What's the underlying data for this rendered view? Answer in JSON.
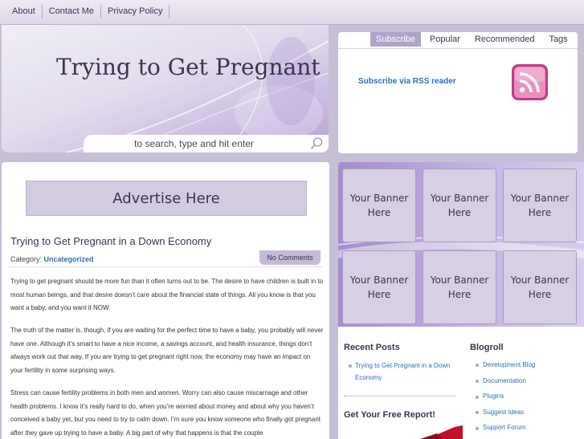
{
  "nav": {
    "items": [
      "About",
      "Contact Me",
      "Privacy Policy"
    ]
  },
  "header": {
    "title": "Trying to Get Pregnant"
  },
  "search": {
    "placeholder": "to search, type and hit enter"
  },
  "tabs": {
    "items": [
      "Subscribe",
      "Popular",
      "Recommended",
      "Tags"
    ],
    "active": "Subscribe"
  },
  "rss": {
    "link_label": "Subscribe via RSS reader"
  },
  "ad": {
    "label": "Advertise Here"
  },
  "post": {
    "title": "Trying to Get Pregnant in a Down Economy",
    "category_label": "Category:",
    "category": "Uncategorized",
    "comments": "No Comments",
    "paragraphs": [
      "Trying to get pregnant should be more fun than it often turns out to be.  The desire to have children is built in to most human beings, and that desire doesn’t care about the financial state of things.  All you know is that you want a baby, and you want it NOW.",
      "The truth of the matter is, though, if you are waiting for the perfect time to have a baby, you probably will never have one.  Although it’s smart to have a nice income, a savings account, and health insurance, things don’t always work out that way.  If you are trying to get pregnant right now, the economy may have an impact on your fertility in some surprising ways.",
      "Stress can cause fertility problems in both men and women.  Worry can also cause miscarriage and other health problems.  I know it’s really hard to do, when you’re worried about money and about why you haven’t conceived a baby yet, but you need to try to calm down.  I’m sure you know someone who finally got pregnant after they gave up trying to have a baby.  A big part of why that happens is that the couple"
    ]
  },
  "banners": [
    "Your Banner Here",
    "Your Banner Here",
    "Your Banner Here",
    "Your Banner Here",
    "Your Banner Here",
    "Your Banner Here"
  ],
  "recent_posts": {
    "title": "Recent Posts",
    "items": [
      "Trying to Get Pregnant in a Down Economy"
    ]
  },
  "blogroll": {
    "title": "Blogroll",
    "items": [
      "Development Blog",
      "Documentation",
      "Plugins",
      "Suggest Ideas",
      "Support Forum"
    ]
  },
  "report": {
    "title": "Get Your Free Report!"
  },
  "colors": {
    "accent": "#b0a3cb",
    "link": "#2a6fbf",
    "title": "#3d3450",
    "background": "#c7bfd6"
  }
}
